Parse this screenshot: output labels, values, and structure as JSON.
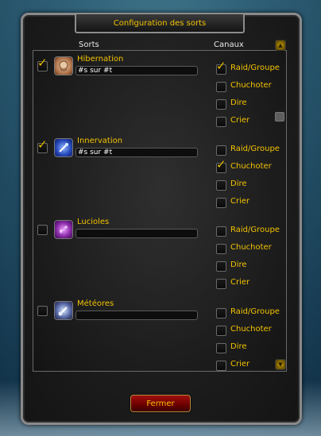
{
  "window": {
    "title": "Configuration des sorts"
  },
  "headers": {
    "sorts": "Sorts",
    "canaux": "Canaux"
  },
  "spells": [
    {
      "name": "Hibernation",
      "enabled": true,
      "message": "#s sur #t",
      "icon": "hibernation-icon",
      "channels": [
        {
          "label": "Raid/Groupe",
          "checked": true
        },
        {
          "label": "Chuchoter",
          "checked": false
        },
        {
          "label": "Dire",
          "checked": false
        },
        {
          "label": "Crier",
          "checked": false
        }
      ]
    },
    {
      "name": "Innervation",
      "enabled": true,
      "message": "#s sur #t",
      "icon": "innervation-icon",
      "channels": [
        {
          "label": "Raid/Groupe",
          "checked": false
        },
        {
          "label": "Chuchoter",
          "checked": true
        },
        {
          "label": "Dire",
          "checked": false
        },
        {
          "label": "Crier",
          "checked": false
        }
      ]
    },
    {
      "name": "Lucioles",
      "enabled": false,
      "message": "",
      "icon": "lucioles-icon",
      "channels": [
        {
          "label": "Raid/Groupe",
          "checked": false
        },
        {
          "label": "Chuchoter",
          "checked": false
        },
        {
          "label": "Dire",
          "checked": false
        },
        {
          "label": "Crier",
          "checked": false
        }
      ]
    },
    {
      "name": "Météores",
      "enabled": false,
      "message": "",
      "icon": "meteores-icon",
      "channels": [
        {
          "label": "Raid/Groupe",
          "checked": false
        },
        {
          "label": "Chuchoter",
          "checked": false
        },
        {
          "label": "Dire",
          "checked": false
        },
        {
          "label": "Crier",
          "checked": false
        }
      ]
    }
  ],
  "footer": {
    "close_label": "Fermer"
  },
  "colors": {
    "gold_text": "#f2c200",
    "panel_bg": "#1c1c1c",
    "button_red": "#a10f0f"
  }
}
